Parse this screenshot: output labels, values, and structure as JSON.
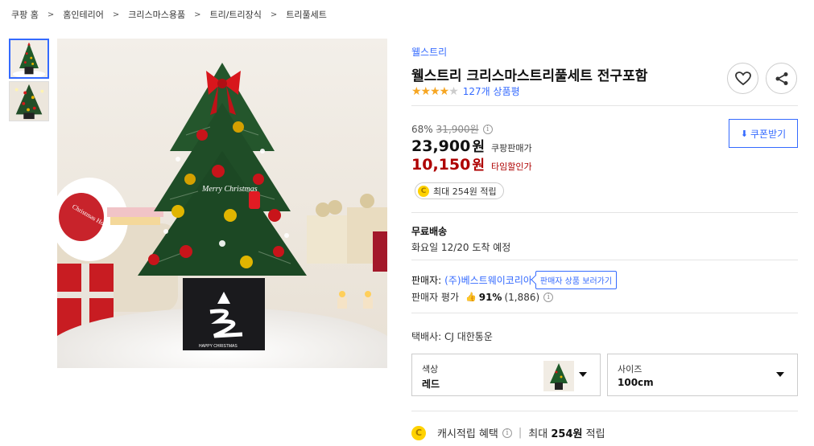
{
  "breadcrumb": [
    "쿠팡 홈",
    "홈인테리어",
    "크리스마스용품",
    "트리/트리장식",
    "트리풀세트"
  ],
  "image": {
    "decoration_text": "Merry Christmas",
    "box_text": "HAPPY CHRISTMAS",
    "pillow_text": "Christmas Holiday"
  },
  "product": {
    "brand": "웰스트리",
    "title": "웰스트리 크리스마스트리풀세트 전구포함",
    "rating_stars": 4,
    "review_count": "127개 상품평"
  },
  "pricing": {
    "discount_rate": "68%",
    "original_price": "31,900원",
    "price": "23,900",
    "price_unit": "원",
    "price_label": "쿠팡판매가",
    "sale_price": "10,150",
    "sale_unit": "원",
    "sale_label": "타임할인가",
    "coupon_label": "쿠폰받기",
    "reward_text": "최대 254원 적립",
    "coin_glyph": "C"
  },
  "shipping": {
    "title": "무료배송",
    "date_text": "화요일 12/20 도착 예정"
  },
  "seller": {
    "label": "판매자:",
    "name": "(주)베스트웨이코리아",
    "view_button": "판매자 상품 보러가기",
    "rating_label": "판매자 평가",
    "rating_pct": "91%",
    "rating_count": "(1,886)",
    "carrier": "택배사: CJ 대한통운"
  },
  "options": {
    "color_label": "색상",
    "color_value": "레드",
    "size_label": "사이즈",
    "size_value": "100cm"
  },
  "cash": {
    "label": "캐시적립 혜택",
    "prefix": "최대",
    "amount": "254원",
    "suffix": "적립"
  },
  "colors": {
    "accent_blue": "#346aff",
    "sale_red": "#ae0000",
    "star": "#f6a623"
  },
  "icons": [
    "heart-icon",
    "share-icon",
    "download-icon",
    "info-icon",
    "coin-icon",
    "thumbs-up-icon",
    "chevron-down-icon"
  ]
}
